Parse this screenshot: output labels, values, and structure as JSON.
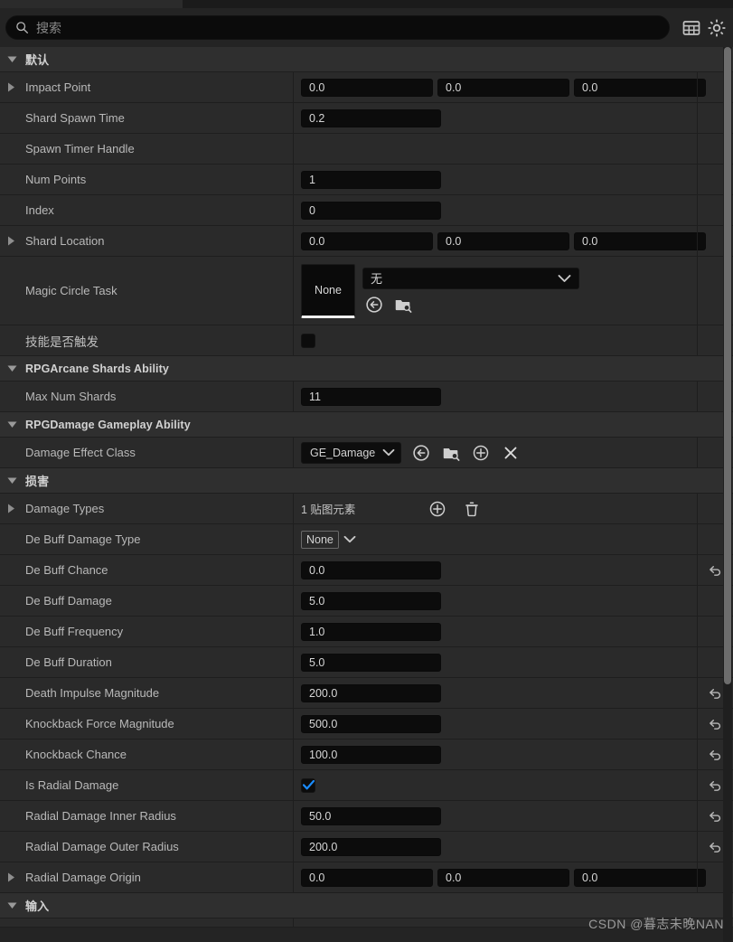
{
  "window": {
    "tab_strip_present": true
  },
  "search": {
    "placeholder": "搜索",
    "value": "",
    "icon": "search-icon"
  },
  "header_buttons": [
    {
      "name": "column-layout-icon",
      "label": ""
    },
    {
      "name": "settings-gear-icon",
      "label": ""
    }
  ],
  "scrollbar": {
    "name": "vertical-scrollbar"
  },
  "watermark": "CSDN  @暮志未晚NAN",
  "categories": {
    "default": "默认",
    "arcane": "RPGArcane Shards Ability",
    "damage_ability": "RPGDamage Gameplay Ability",
    "damage": "损害",
    "input": "输入"
  },
  "rows": {
    "impact_point": {
      "label": "Impact Point",
      "x": "0.0",
      "y": "0.0",
      "z": "0.0"
    },
    "shard_spawn_time": {
      "label": "Shard Spawn Time",
      "value": "0.2"
    },
    "spawn_timer_handle": {
      "label": "Spawn Timer Handle",
      "value": ""
    },
    "num_points": {
      "label": "Num Points",
      "value": "1"
    },
    "index": {
      "label": "Index",
      "value": "0"
    },
    "shard_location": {
      "label": "Shard Location",
      "x": "0.0",
      "y": "0.0",
      "z": "0.0"
    },
    "magic_circle_task": {
      "label": "Magic Circle Task",
      "thumb": "None",
      "asset": "无"
    },
    "skill_triggered": {
      "label": "技能是否触发",
      "checked": false
    },
    "max_num_shards": {
      "label": "Max Num Shards",
      "value": "11"
    },
    "damage_effect_class": {
      "label": "Damage Effect Class",
      "value": "GE_Damage"
    },
    "damage_types": {
      "label": "Damage Types",
      "value": "1 贴图元素"
    },
    "de_buff_damage_type": {
      "label": "De Buff Damage Type",
      "value": "None"
    },
    "de_buff_chance": {
      "label": "De Buff Chance",
      "value": "0.0"
    },
    "de_buff_damage": {
      "label": "De Buff Damage",
      "value": "5.0"
    },
    "de_buff_frequency": {
      "label": "De Buff Frequency",
      "value": "1.0"
    },
    "de_buff_duration": {
      "label": "De Buff Duration",
      "value": "5.0"
    },
    "death_impulse": {
      "label": "Death Impulse Magnitude",
      "value": "200.0"
    },
    "knockback_force": {
      "label": "Knockback Force Magnitude",
      "value": "500.0"
    },
    "knockback_chance": {
      "label": "Knockback Chance",
      "value": "100.0"
    },
    "is_radial_damage": {
      "label": "Is Radial Damage",
      "checked": true
    },
    "radial_inner": {
      "label": "Radial Damage Inner Radius",
      "value": "50.0"
    },
    "radial_outer": {
      "label": "Radial Damage Outer Radius",
      "value": "200.0"
    },
    "radial_origin": {
      "label": "Radial Damage Origin",
      "x": "0.0",
      "y": "0.0",
      "z": "0.0"
    }
  },
  "icons": {
    "use_selected": "use-selected-asset-icon",
    "browse": "browse-asset-icon",
    "create_new": "create-new-asset-icon",
    "clear": "clear-asset-icon",
    "add_element": "add-array-element-icon",
    "delete_all": "delete-array-icon",
    "revert": "revert-to-default-icon"
  },
  "colors": {
    "accent_checkbox": "#1a8cff",
    "panel_bg": "#242424",
    "row_bg": "#2a2a2a",
    "category_bg": "#2f2f2f",
    "field_bg": "#0c0c0c",
    "text": "#b9b9b9"
  }
}
